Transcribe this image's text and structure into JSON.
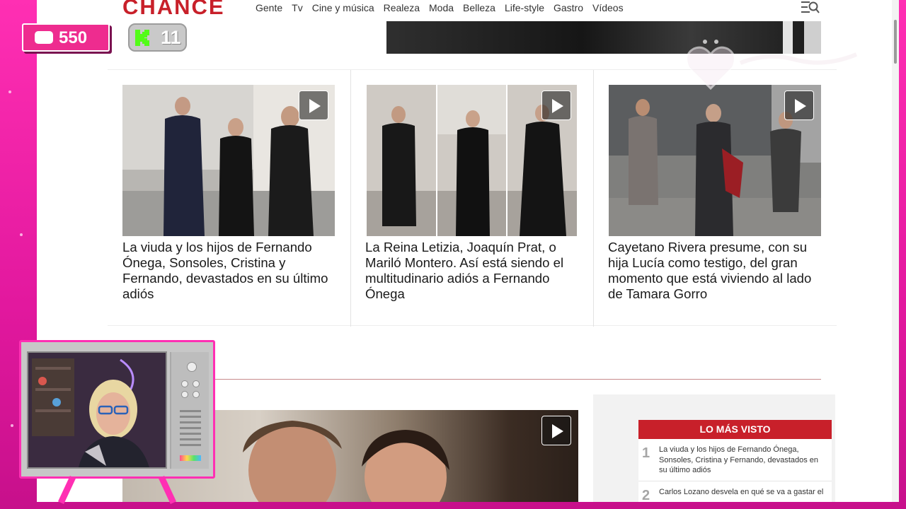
{
  "site": {
    "logo": "CHANCE",
    "nav": [
      "Gente",
      "Tv",
      "Cine y música",
      "Realeza",
      "Moda",
      "Belleza",
      "Life-style",
      "Gastro",
      "Vídeos"
    ]
  },
  "cards": [
    {
      "title": "La viuda y los hijos de Fernando Ónega, Sonsoles, Cristina y Fernando, devastados en su último adiós"
    },
    {
      "title": "La Reina Letizia, Joaquín Prat, o Mariló Montero. Así está siendo el multitudinario adiós a Fernando Ónega"
    },
    {
      "title": "Cayetano Rivera presume, con su hija Lucía como testigo, del gran momento que está viviendo al lado de Tamara Gorro"
    }
  ],
  "most_viewed": {
    "header": "LO MÁS VISTO",
    "items": [
      {
        "rank": "1",
        "text": "La viuda y los hijos de Fernando Ónega, Sonsoles, Cristina y Fernando, devastados en su último adiós"
      },
      {
        "rank": "2",
        "text": "Carlos Lozano desvela en qué se va a gastar el"
      }
    ]
  },
  "overlay": {
    "chat_count": "550",
    "kick_count": "11"
  },
  "colors": {
    "brand_red": "#c8202a",
    "stream_pink": "#ff2fb3",
    "kick_green": "#53fc18"
  }
}
